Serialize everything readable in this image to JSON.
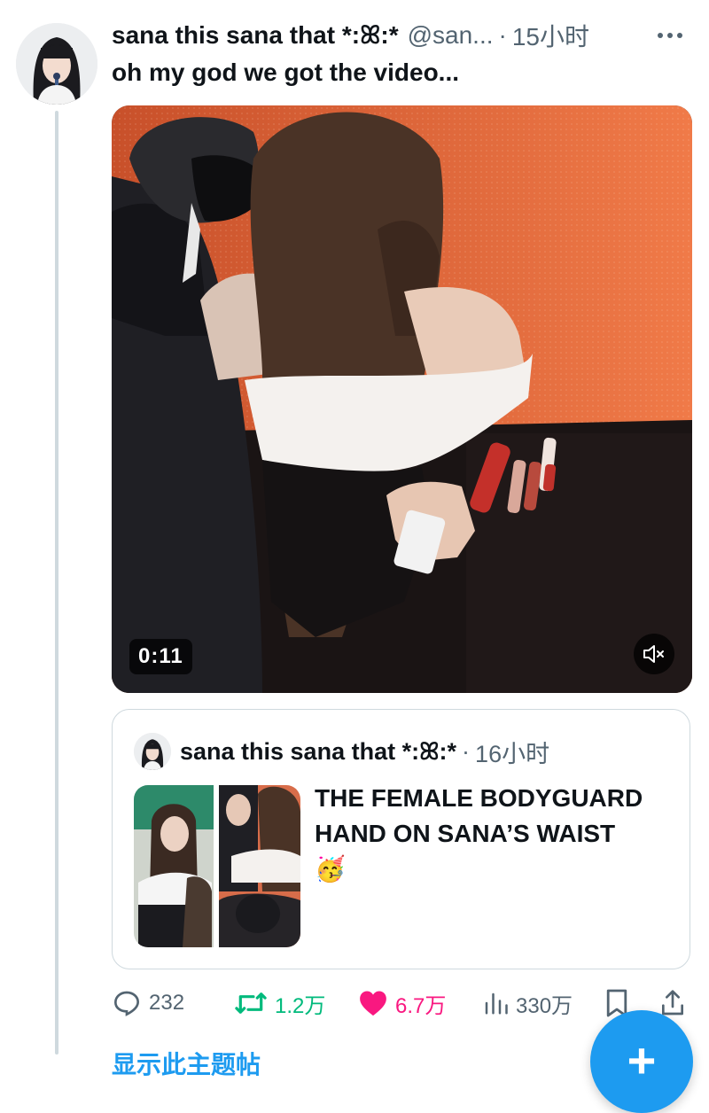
{
  "tweet": {
    "display_name": "sana this sana that *:ꕤ:*",
    "handle": "@san...",
    "separator": "·",
    "time": "15小时",
    "text": "oh my god we got the video...",
    "more_icon": "more-horizontal-icon",
    "video": {
      "duration": "0:11",
      "mute_icon": "volume-muted-icon"
    }
  },
  "quote": {
    "display_name": "sana this sana that *:ꕤ:*",
    "separator": "·",
    "time": "16小时",
    "text": "THE FEMALE BODYGUARD HAND ON SANA’S WAIST",
    "emoji": "🥳"
  },
  "actions": {
    "reply": {
      "icon": "reply-icon",
      "count": "232"
    },
    "retweet": {
      "icon": "retweet-icon",
      "count": "1.2万",
      "color": "#00ba7c"
    },
    "like": {
      "icon": "heart-icon",
      "count": "6.7万",
      "color": "#f91880"
    },
    "views": {
      "icon": "views-icon",
      "count": "330万"
    },
    "bookmark": {
      "icon": "bookmark-icon"
    },
    "share": {
      "icon": "share-icon"
    }
  },
  "compose_fab": {
    "icon": "plus-icon",
    "label": "+"
  },
  "show_thread": "显示此主题帖",
  "colors": {
    "accent": "#1d9bf0",
    "muted": "#536471",
    "border": "#cfd9de"
  }
}
